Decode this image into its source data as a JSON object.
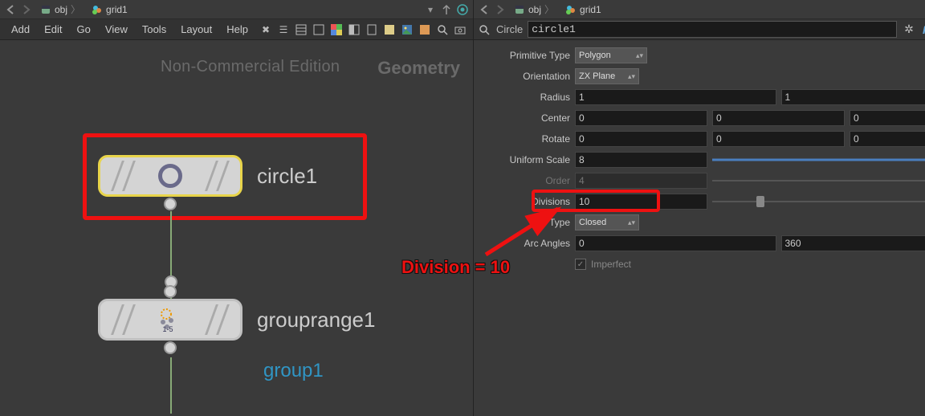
{
  "left": {
    "path": [
      "obj",
      "grid1"
    ],
    "menus": [
      "Add",
      "Edit",
      "Go",
      "View",
      "Tools",
      "Layout",
      "Help"
    ],
    "watermark_nc": "Non-Commercial Edition",
    "watermark_geo": "Geometry",
    "node1_label": "circle1",
    "node2_label": "grouprange1",
    "link_label": "group1"
  },
  "right": {
    "path": [
      "obj",
      "grid1"
    ],
    "type_label": "Circle",
    "name_value": "circle1",
    "params": {
      "primtype_label": "Primitive Type",
      "primtype_value": "Polygon",
      "orient_label": "Orientation",
      "orient_value": "ZX Plane",
      "radius_label": "Radius",
      "radius_x": "1",
      "radius_y": "1",
      "center_label": "Center",
      "center_x": "0",
      "center_y": "0",
      "center_z": "0",
      "rotate_label": "Rotate",
      "rotate_x": "0",
      "rotate_y": "0",
      "rotate_z": "0",
      "scale_label": "Uniform Scale",
      "scale_value": "8",
      "order_label": "Order",
      "order_value": "4",
      "divisions_label": "Divisions",
      "divisions_value": "10",
      "arctype_label": "Arc Type",
      "arctype_value": "Closed",
      "arcangles_label": "Arc Angles",
      "arc_a": "0",
      "arc_b": "360",
      "imperfect_label": "Imperfect"
    }
  },
  "annotation": "Division = 10"
}
